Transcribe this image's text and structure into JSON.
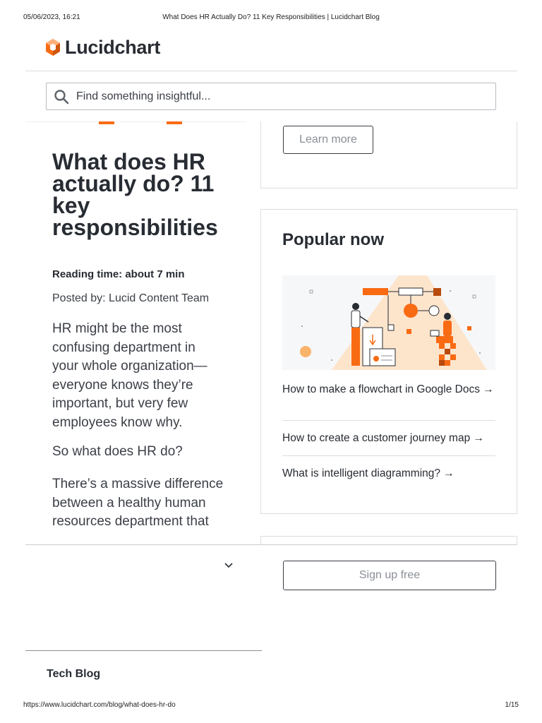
{
  "print_header": {
    "datetime": "05/06/2023, 16:21",
    "page_title": "What Does HR Actually Do? 11 Key Responsibilities | Lucidchart Blog"
  },
  "print_footer": {
    "url": "https://www.lucidchart.com/blog/what-does-hr-do",
    "page_count": "1/15"
  },
  "brand": {
    "name": "Lucidchart",
    "accent_color": "#f96b13"
  },
  "search": {
    "placeholder": "Find something insightful..."
  },
  "article": {
    "title": "What does HR actually do? 11 key responsibilities",
    "reading_time": "Reading time: about 7 min",
    "posted_by": "Posted by: Lucid Content Team",
    "paragraphs": [
      "HR might be the most confusing department in your whole organization—everyone knows they’re important, but very few employees know why.",
      "So what does HR do?",
      "There’s a massive difference between a healthy human resources department that"
    ]
  },
  "sidebar": {
    "learn_more_label": "Learn more",
    "popular": {
      "heading": "Popular now",
      "links": [
        "How to make a flowchart in Google Docs →",
        "How to create a customer journey map →",
        "What is intelligent diagramming? →"
      ]
    }
  },
  "sticky_bar": {
    "signup_label": "Sign up free"
  },
  "footer": {
    "tech_blog": "Tech Blog"
  }
}
